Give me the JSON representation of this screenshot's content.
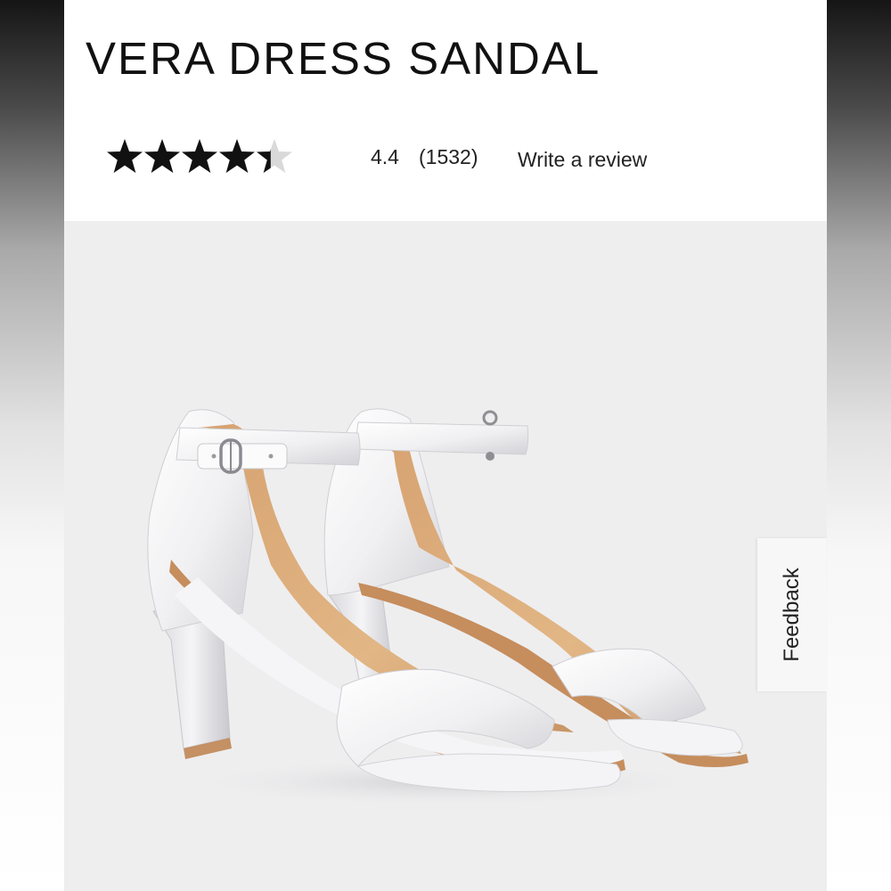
{
  "product": {
    "title": "VERA DRESS SANDAL",
    "rating": 4.4,
    "rating_text": "4.4",
    "max_rating": 5,
    "review_count": "(1532)",
    "write_review_label": "Write a review",
    "image_name": "white-satin-block-heel-sandals"
  },
  "feedback": {
    "label": "Feedback"
  },
  "colors": {
    "star_fill": "#111111",
    "star_empty": "#d9d9d9",
    "image_background": "#eeeeef",
    "side_gradient_dark": "#151515"
  }
}
